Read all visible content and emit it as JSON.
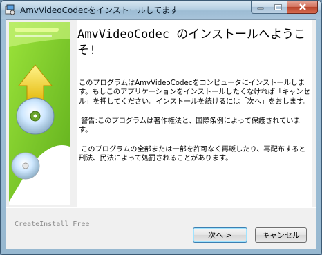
{
  "window": {
    "title": "AmvVideoCodecをインストールしてます"
  },
  "content": {
    "heading": "AmvVideoCodec のインストールへようこそ!",
    "paragraph1": "このプログラムはAmvVideoCodecをコンピュータにインストールします。もしこのアプリケーションをインストールしたくなければ「キャンセル」を押してください。インストールを続けるには「次へ」をおします。",
    "paragraph2": " 警告:このプログラムは著作権法と、国際条例によって保護されています。",
    "paragraph3": " このプログラムの全部または一部を許可なく再販したり、再配布すると刑法、民法によって処罰されることがあります。"
  },
  "footer": {
    "brand": "CreateInstall Free"
  },
  "buttons": {
    "next": "次へ >",
    "cancel": "キャンセル"
  },
  "colors": {
    "sidebar_green": "#7fcf2a",
    "arrow_yellow": "#f0d020",
    "titlebar": "#b6cfe2"
  },
  "icons": {
    "app": "installer-icon",
    "minimize": "minimize-icon",
    "maximize": "maximize-icon",
    "close": "close-icon"
  }
}
